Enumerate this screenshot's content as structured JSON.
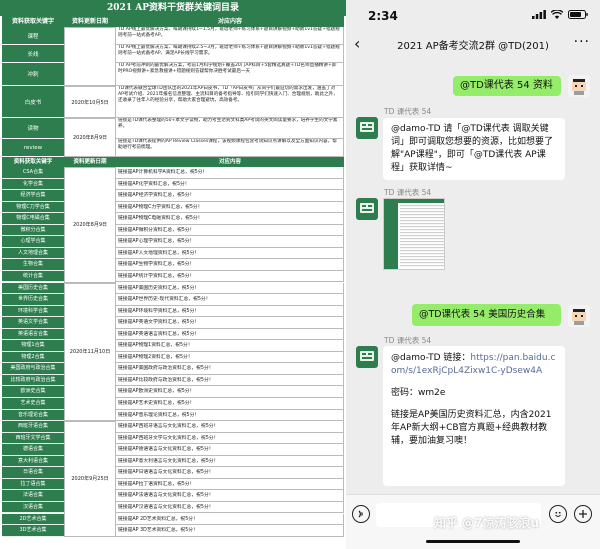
{
  "doc": {
    "title": "2021 AP资料干货群关键词目录",
    "header": {
      "col1": "资料获取关键字",
      "col2": "资料更新日期",
      "col3": "对应内容"
    },
    "top_rows": [
      {
        "cat": "课程",
        "date": "",
        "text": "TD AP线上最优解决方案、每期课持续1~1.5月，靠谱老师+练习体系+题目讲解视频+助教1v1答疑+错题规则考前一站式备考AP。"
      },
      {
        "cat": "长线",
        "date": "",
        "text": "TD AP线上最优解决方案、每期课持续2.5~3月，靠谱老师+练习体系+题目讲解视频+助教1v1答疑+错题规则考前一站式备考AP、满足AP长线学习需求。"
      },
      {
        "cat": "冲刺",
        "date": "",
        "text": "TD AP考前冲刺的最优解决方案，考前1月科学规划+覆盖20门AP科目+5套精选真题+TD名师直播精讲+即时PRO视频讲+紧急救援讲+错题规则答疑帮你决胜考试最后一天"
      },
      {
        "cat": "白皮书",
        "date": "2020年10月5日",
        "text": "TD课代表联合全球TD团队出的2021年AP白皮书，TD「AP白皮书」从同学们最迫切的需求出发，涵盖了对AP考试介绍、2021年报名信息整理、主流科目的备考指导等、指引同学们快速入门、合理规划，助此之外，还收录了往年人的经验分享，帮助大家合理避坑，高效备考。"
      },
      {
        "cat": "读物",
        "date": "2020年8月9日",
        "text": "链接是TD课代表整理的50+本文学读物，助力考生达到文科类AP考试的英文阅读量要求，培养学生的文学素养。"
      },
      {
        "cat": "review",
        "date": "",
        "text": "链接是TD课代表提供的AP Review Classes课程，该视频课程包含考试知识点讲解以及全方面知识内容，帮助进行考前梳理。"
      }
    ],
    "sub_header": {
      "col1": "资料获取关键字",
      "col2": "资料更新日期",
      "col3": "对应内容"
    },
    "list_rows": [
      {
        "cat": "CSA合集",
        "text": "链接是AP计算机科学A资料汇总，祝5分！"
      },
      {
        "cat": "化学合集",
        "text": "链接是AP化学资料汇总，祝5分！"
      },
      {
        "cat": "经济学合集",
        "text": "链接是AP经济学资料汇总，祝5分！"
      },
      {
        "cat": "物理C力学合集",
        "text": "链接是AP物理C力学资料汇总，祝5分！"
      },
      {
        "cat": "物理C电磁合集",
        "text": "链接是AP物理C电磁资料汇总，祝5分！"
      },
      {
        "cat": "微积分合集",
        "text": "链接是AP微积分资料汇总，祝5分！"
      },
      {
        "cat": "心理学合集",
        "text": "链接是AP心理学资料汇总，祝5分！"
      },
      {
        "cat": "人文地理合集",
        "text": "链接是AP人文地理资料汇总，祝5分！"
      },
      {
        "cat": "生物合集",
        "text": "链接是AP生物学资料汇总，祝5分！"
      },
      {
        "cat": "统计合集",
        "text": "链接是AP统计学资料汇总，祝5分！"
      },
      {
        "cat": "美国历史合集",
        "text": "链接是AP美国历史资料汇总，祝5分！"
      },
      {
        "cat": "世界历史合集",
        "text": "链接是AP世界历史-现代资料汇总，祝5分！"
      },
      {
        "cat": "环境科学合集",
        "text": "链接是AP环境科学资料汇总，祝5分！"
      },
      {
        "cat": "英语文学合集",
        "text": "链接是AP英语文学资料汇总，祝5分！"
      },
      {
        "cat": "英语语言合集",
        "text": "链接是AP英语语言资料汇总，祝5分！"
      },
      {
        "cat": "物理1合集",
        "text": "链接是AP物理1资料汇总，祝5分！"
      },
      {
        "cat": "物理2合集",
        "text": "链接是AP物理2资料汇总，祝5分！"
      },
      {
        "cat": "美国政府与政治合集",
        "text": "链接是AP美国政府与政治资料汇总，祝5分！"
      },
      {
        "cat": "比较政府与政治合集",
        "text": "链接是AP比较政府与政治资料汇总，祝5分！"
      },
      {
        "cat": "欧洲史合集",
        "text": "链接是AP欧洲史资料汇总，祝5分！"
      },
      {
        "cat": "艺术史合集",
        "text": "链接是AP艺术史资料汇总，祝5分！"
      },
      {
        "cat": "音乐理论合集",
        "text": "链接是AP音乐理论资料汇总，祝5分！"
      },
      {
        "cat": "西班牙语合集",
        "text": "链接是AP西班牙语言与文化资料汇总，祝5分！"
      },
      {
        "cat": "西班牙文学合集",
        "text": "链接是AP西班牙文学与文化资料汇总，祝5分！"
      },
      {
        "cat": "德语合集",
        "text": "链接是AP德语语言与文化资料汇总，祝5分！"
      },
      {
        "cat": "意大利语合集",
        "text": "链接是AP意大利语言与文化资料汇总，祝5分！"
      },
      {
        "cat": "日语合集",
        "text": "链接是AP日语语言与文化资料汇总，祝5分！"
      },
      {
        "cat": "拉丁语合集",
        "text": "链接是AP拉丁语资料汇总，祝5分！"
      },
      {
        "cat": "法语合集",
        "text": "链接是AP法语语言与文化资料汇总，祝5分！"
      },
      {
        "cat": "汉语合集",
        "text": "链接是AP汉语语言与文化资料汇总，祝5分！"
      },
      {
        "cat": "2D艺术合集",
        "text": "链接是AP 2D艺术资料汇总，祝5分！"
      },
      {
        "cat": "3D艺术合集",
        "text": "链接是AP 3D艺术资料汇总，祝5分！"
      }
    ],
    "list_dates": [
      "2020年8月9日",
      "2020年11月10日",
      "2020年9月25日"
    ]
  },
  "phone": {
    "time": "2:34",
    "chat_title": "2021 AP备考交流2群 @TD(201)",
    "messages": {
      "m1": "@TD课代表 54 资料",
      "sender1": "TD 课代表 54",
      "m2": "@damo-TD 请「@TD课代表 调取关键词」即可调取您想要的资源，比如想要了解\"AP课程\"，即可「@TD课代表 AP课程」获取详情~",
      "sender2": "TD 课代表 54",
      "m4": "@TD课代表 54 美国历史合集",
      "sender3": "TD 课代表 54",
      "m5_prefix": "@damo-TD 链接：",
      "m5_link": "https://pan.baidu.com/s/1exRjCpL4Zixw1C-yDsew4A",
      "m5_code": "密码：wm2e",
      "m5_body": "链接是AP美国历史资料汇总，内含2021年AP新大纲+CB官方真题+经典教材教辅，要加油复习噢！"
    },
    "watermark": "知乎 @7惊涛骇浪u"
  },
  "colors": {
    "brand_green": "#2e7d4f",
    "bubble_green": "#95ec69",
    "chat_bg": "#ededed",
    "link": "#576b95"
  },
  "icons": [
    "signal-icon",
    "wifi-icon",
    "battery-icon",
    "back-arrow-icon",
    "more-icon",
    "voice-icon",
    "emoji-icon",
    "plus-icon"
  ]
}
